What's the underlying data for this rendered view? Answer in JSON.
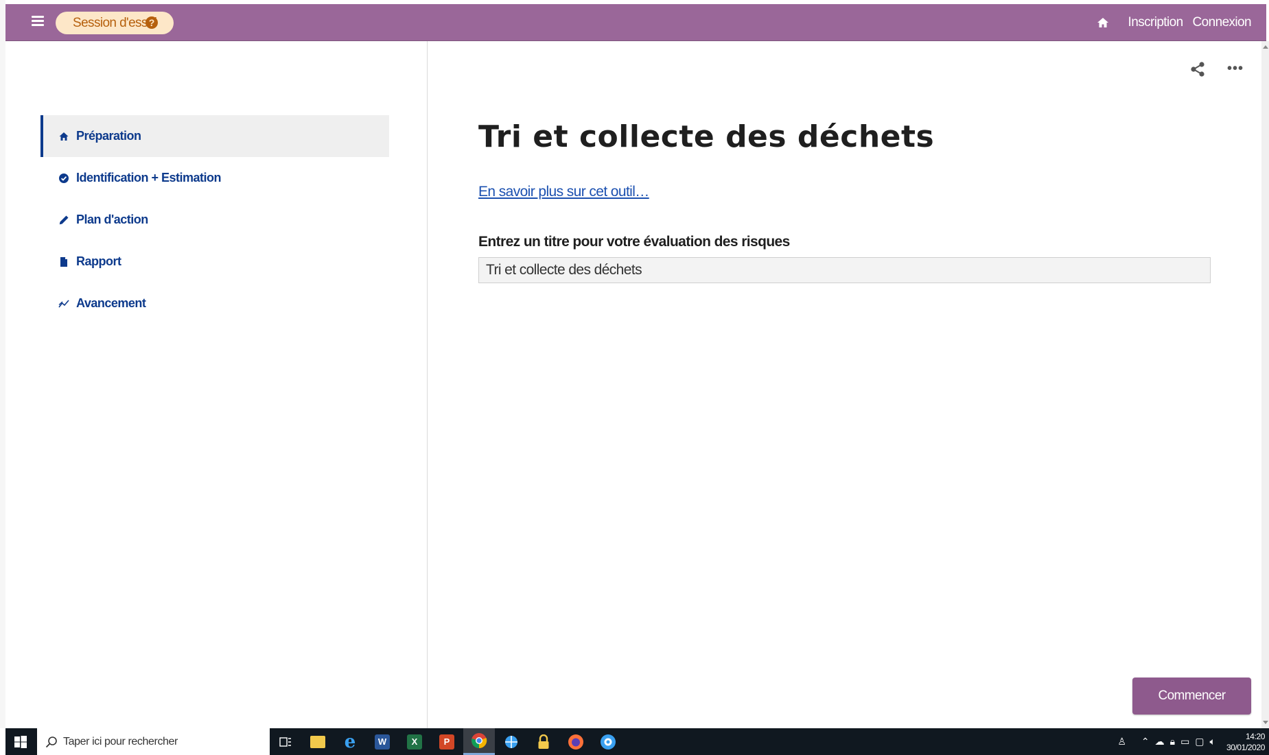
{
  "header": {
    "session_label": "Session d'essai",
    "help_icon": "question-circle-icon",
    "home_icon": "home-icon",
    "links": [
      "Inscription",
      "Connexion"
    ],
    "bar_color": "#9a6799"
  },
  "sidebar": {
    "items": [
      {
        "label": "Préparation",
        "icon": "home-icon",
        "active": true
      },
      {
        "label": "Identification + Estimation",
        "icon": "check-circle-icon",
        "active": false
      },
      {
        "label": "Plan d'action",
        "icon": "pencil-icon",
        "active": false
      },
      {
        "label": "Rapport",
        "icon": "document-icon",
        "active": false
      },
      {
        "label": "Avancement",
        "icon": "trend-chart-icon",
        "active": false
      }
    ],
    "accent_color": "#0d3a8c"
  },
  "main": {
    "title": "Tri et collecte des déchets",
    "learn_more": "En savoir plus sur cet outil…",
    "field_label": "Entrez un titre pour votre évaluation des risques",
    "field_value": "Tri et collecte des déchets",
    "start_button": "Commencer",
    "toolbar_icons": [
      "share-icon",
      "more-options-icon"
    ]
  },
  "taskbar": {
    "search_placeholder": "Taper ici pour rechercher",
    "time": "14:20",
    "date": "30/01/2020",
    "apps": [
      "task-view",
      "file-explorer",
      "internet-explorer",
      "word",
      "excel",
      "powerpoint",
      "chrome",
      "network-app",
      "lock-app",
      "firefox",
      "assistance-app"
    ]
  }
}
